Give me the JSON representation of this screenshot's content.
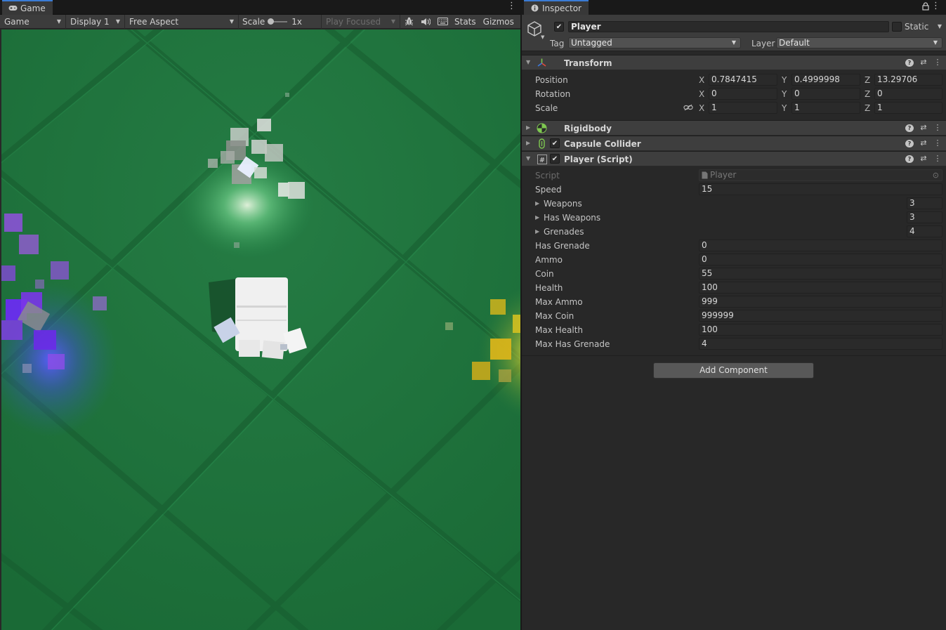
{
  "game": {
    "tab_label": "Game",
    "toolbar": {
      "mode": "Game",
      "display": "Display 1",
      "aspect": "Free Aspect",
      "scale_label": "Scale",
      "scale_value": "1x",
      "play_mode": "Play Focused",
      "stats_label": "Stats",
      "gizmos_label": "Gizmos"
    }
  },
  "inspector": {
    "tab_label": "Inspector",
    "object": {
      "name": "Player",
      "active": true,
      "static_label": "Static",
      "tag_label": "Tag",
      "tag_value": "Untagged",
      "layer_label": "Layer",
      "layer_value": "Default"
    },
    "transform": {
      "title": "Transform",
      "position_label": "Position",
      "rotation_label": "Rotation",
      "scale_label": "Scale",
      "axis_x": "X",
      "axis_y": "Y",
      "axis_z": "Z",
      "position": {
        "x": "0.7847415",
        "y": "0.4999998",
        "z": "13.29706"
      },
      "rotation": {
        "x": "0",
        "y": "0",
        "z": "0"
      },
      "scale": {
        "x": "1",
        "y": "1",
        "z": "1"
      }
    },
    "rigidbody": {
      "title": "Rigidbody"
    },
    "capsule_collider": {
      "title": "Capsule Collider",
      "enabled": true
    },
    "player_script": {
      "title": "Player (Script)",
      "enabled": true,
      "script_label": "Script",
      "script_value": "Player",
      "speed_label": "Speed",
      "speed": "15",
      "weapons_label": "Weapons",
      "weapons": "3",
      "has_weapons_label": "Has Weapons",
      "has_weapons": "3",
      "grenades_label": "Grenades",
      "grenades": "4",
      "has_grenade_label": "Has Grenade",
      "has_grenade": "0",
      "ammo_label": "Ammo",
      "ammo": "0",
      "coin_label": "Coin",
      "coin": "55",
      "health_label": "Health",
      "health": "100",
      "max_ammo_label": "Max Ammo",
      "max_ammo": "999",
      "max_coin_label": "Max Coin",
      "max_coin": "999999",
      "max_health_label": "Max Health",
      "max_health": "100",
      "max_has_grenade_label": "Max Has Grenade",
      "max_has_grenade": "4"
    },
    "add_component_label": "Add Component"
  },
  "colors": {
    "ground": "#1e6e3a",
    "tile_line": "#185a30",
    "accent": "#3a7bd5",
    "purple_particles": "#8a52d6",
    "yellow_particles": "#d8b41a",
    "white_particles": "#d8dcd8"
  }
}
